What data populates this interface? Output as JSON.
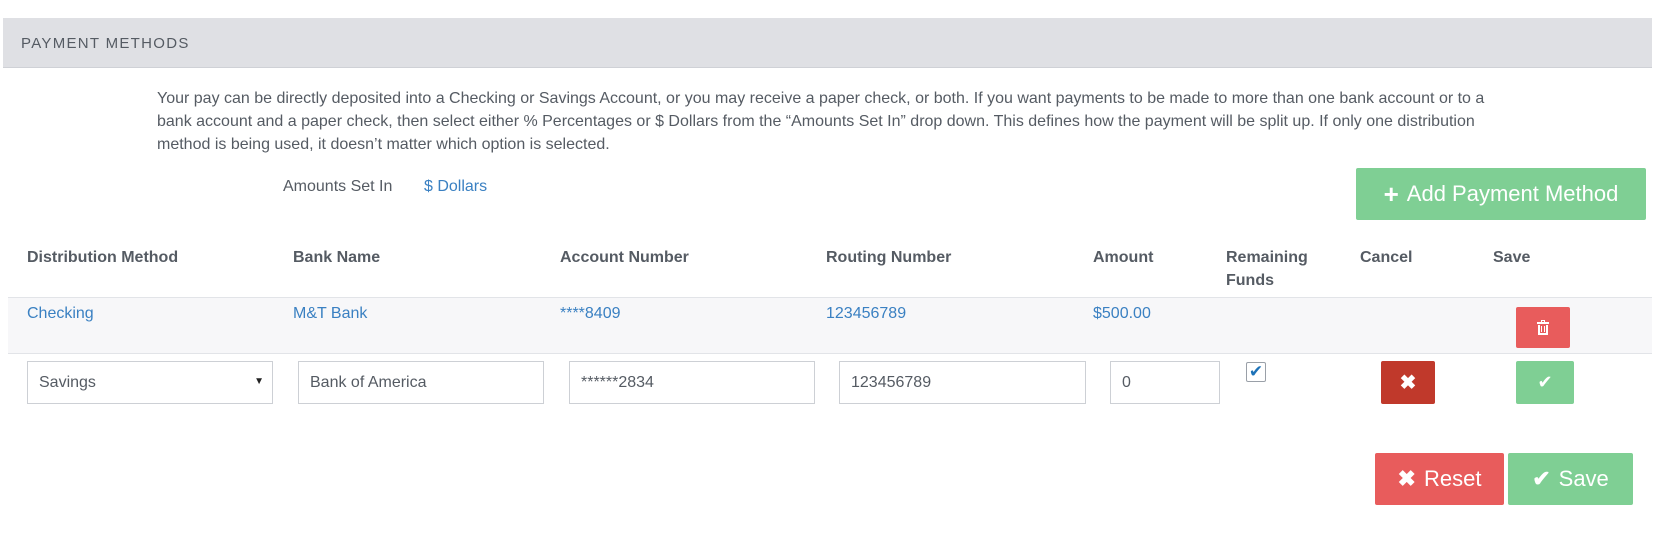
{
  "panel": {
    "title": "PAYMENT METHODS"
  },
  "intro": "Your pay can be directly deposited into a Checking or Savings Account, or you may receive a paper check, or both. If you want payments to be made to more than one bank account or to a bank account and a paper check, then select either % Percentages or $ Dollars from the “Amounts Set In” drop down. This defines how the payment will be split up. If only one distribution method is being used, it doesn’t matter which option is selected.",
  "amounts": {
    "label": "Amounts Set In",
    "value": "$ Dollars"
  },
  "add_button": {
    "label": "Add Payment Method",
    "icon": "plus-icon"
  },
  "table": {
    "headers": {
      "distribution": "Distribution Method",
      "bank": "Bank Name",
      "account": "Account Number",
      "routing": "Routing Number",
      "amount": "Amount",
      "remaining": "Remaining Funds",
      "cancel": "Cancel",
      "save": "Save"
    },
    "row1": {
      "distribution": "Checking",
      "bank": "M&T Bank",
      "account": "****8409",
      "routing": "123456789",
      "amount": "$500.00"
    },
    "edit_row": {
      "distribution": "Savings",
      "bank": "Bank of America",
      "account": "******2834",
      "routing": "123456789",
      "amount": "0",
      "remaining_checked": true
    }
  },
  "footer": {
    "reset_label": "Reset",
    "save_label": "Save"
  },
  "colors": {
    "accent": "#3a80c2",
    "green": "#7fcf94",
    "red": "#e85c5c",
    "dark_red": "#c0392b",
    "header_bg": "#dfe0e4"
  }
}
